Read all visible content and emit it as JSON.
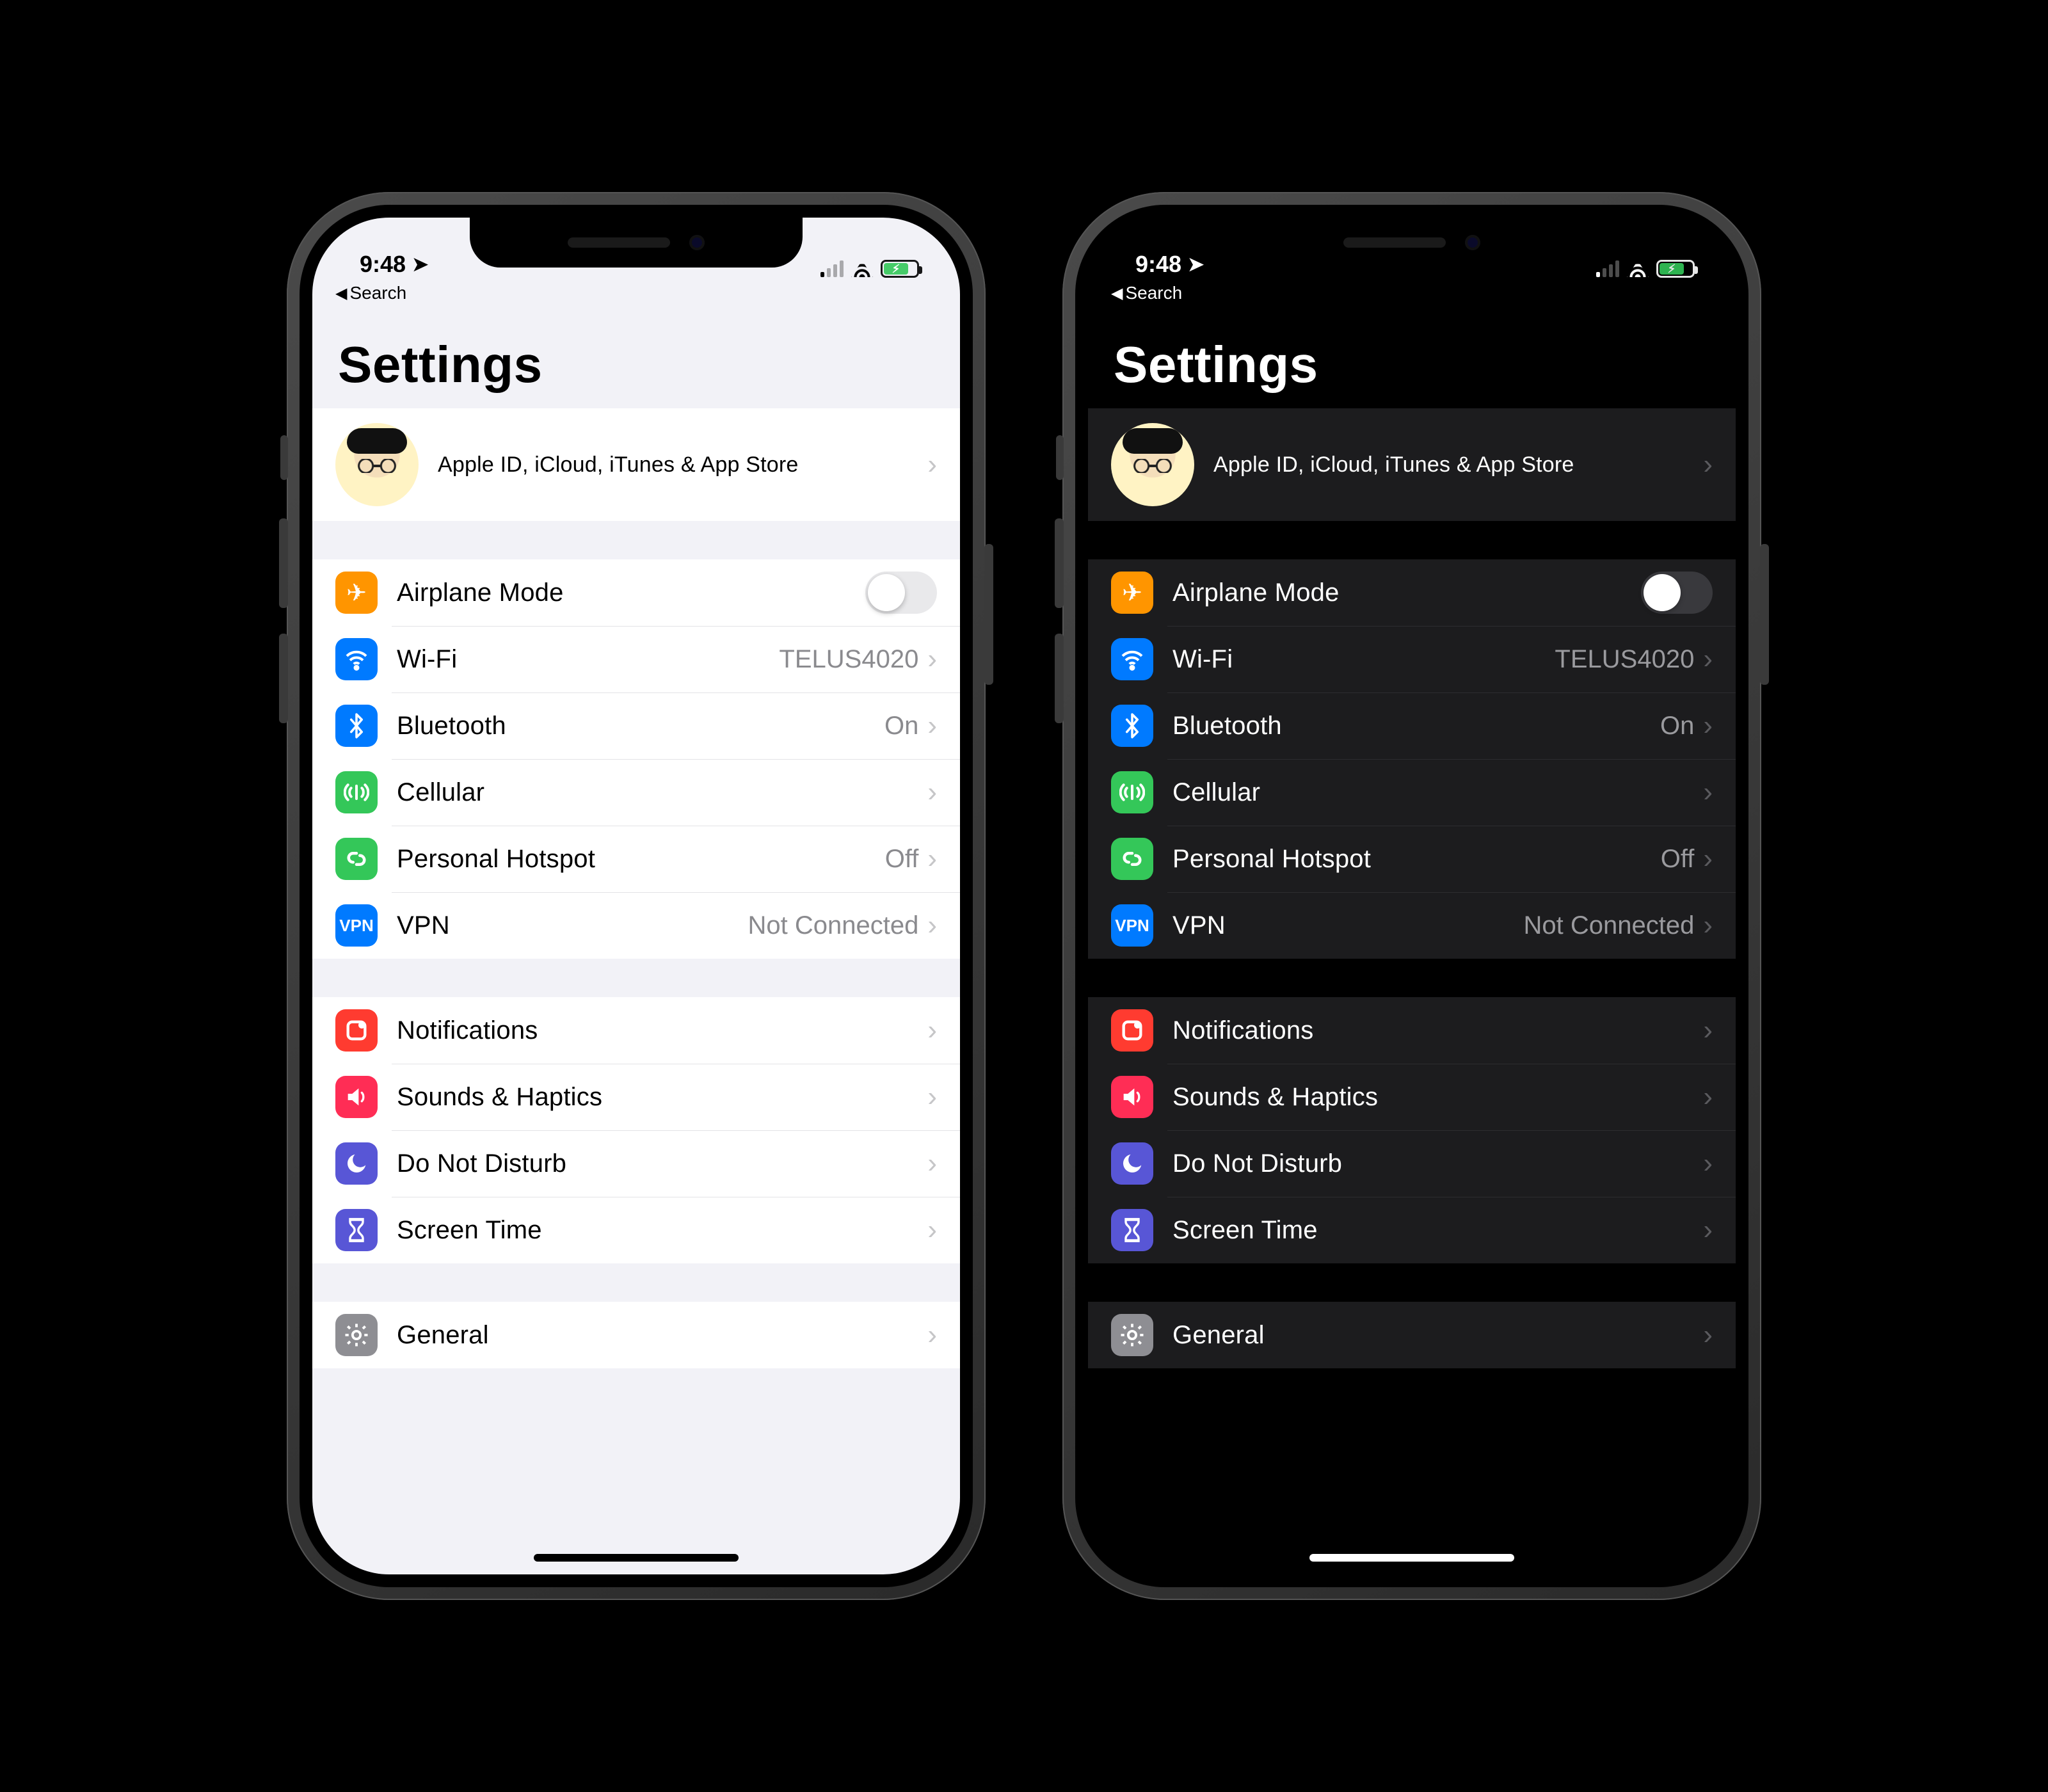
{
  "status": {
    "time": "9:48",
    "breadcrumb": "Search",
    "signal_bars_active": 1,
    "battery_state": "charging"
  },
  "title": "Settings",
  "profile": {
    "subtitle": "Apple ID, iCloud, iTunes & App Store"
  },
  "groups": [
    {
      "id": "connectivity",
      "items": [
        {
          "id": "airplane",
          "label": "Airplane Mode",
          "icon": "airplane-icon",
          "type": "switch",
          "on": false
        },
        {
          "id": "wifi",
          "label": "Wi-Fi",
          "icon": "wifi-icon",
          "value": "TELUS4020",
          "type": "link"
        },
        {
          "id": "bluetooth",
          "label": "Bluetooth",
          "icon": "bluetooth-icon",
          "value": "On",
          "type": "link"
        },
        {
          "id": "cellular",
          "label": "Cellular",
          "icon": "cellular-icon",
          "type": "link"
        },
        {
          "id": "hotspot",
          "label": "Personal Hotspot",
          "icon": "hotspot-icon",
          "value": "Off",
          "type": "link"
        },
        {
          "id": "vpn",
          "label": "VPN",
          "icon": "vpn-icon",
          "value": "Not Connected",
          "type": "link"
        }
      ]
    },
    {
      "id": "alerts",
      "items": [
        {
          "id": "notifications",
          "label": "Notifications",
          "icon": "notifications-icon",
          "type": "link"
        },
        {
          "id": "sounds",
          "label": "Sounds & Haptics",
          "icon": "sounds-icon",
          "type": "link"
        },
        {
          "id": "dnd",
          "label": "Do Not Disturb",
          "icon": "dnd-icon",
          "type": "link"
        },
        {
          "id": "screentime",
          "label": "Screen Time",
          "icon": "screentime-icon",
          "type": "link"
        }
      ]
    },
    {
      "id": "general",
      "items": [
        {
          "id": "general",
          "label": "General",
          "icon": "general-icon",
          "type": "link"
        }
      ]
    }
  ],
  "icons": {
    "airplane-icon": "✈︎",
    "wifi-icon": "wifi-svg",
    "bluetooth-icon": "bt-svg",
    "cellular-icon": "cell-svg",
    "hotspot-icon": "link-svg",
    "vpn-icon": "VPN",
    "notifications-icon": "notif-svg",
    "sounds-icon": "sound-svg",
    "dnd-icon": "moon-svg",
    "screentime-icon": "hourglass-svg",
    "general-icon": "gear-svg"
  }
}
